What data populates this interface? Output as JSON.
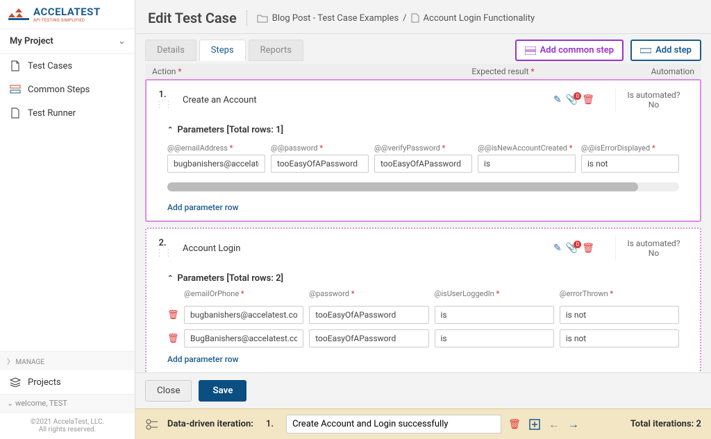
{
  "brand": {
    "name": "ACCELATEST",
    "tagline": "API TESTING SIMPLIFIED"
  },
  "sidebar": {
    "project": "My Project",
    "items": [
      {
        "label": "Test Cases"
      },
      {
        "label": "Common Steps"
      },
      {
        "label": "Test Runner"
      }
    ],
    "manage": "MANAGE",
    "projects": "Projects",
    "welcome": "welcome, TEST",
    "copyright1": "©2021 AccelaTest, LLC.",
    "copyright2": "All rights reserved."
  },
  "header": {
    "title": "Edit Test Case",
    "crumb1": "Blog Post - Test Case Examples",
    "crumb2": "Account Login Functionality"
  },
  "tabs": {
    "details": "Details",
    "steps": "Steps",
    "reports": "Reports"
  },
  "buttons": {
    "addCommon": "Add common step",
    "addStep": "Add step",
    "close": "Close",
    "save": "Save"
  },
  "cols": {
    "action": "Action",
    "expected": "Expected result",
    "automation": "Automation"
  },
  "steps": [
    {
      "num": "1.",
      "title": "Create an Account",
      "autoLabel": "Is automated?",
      "autoVal": "No",
      "paramsHdr": "Parameters [Total rows: 1]",
      "params": [
        {
          "label": "@@emailAddress"
        },
        {
          "label": "@@password"
        },
        {
          "label": "@@verifyPassword"
        },
        {
          "label": "@@isNewAccountCreated"
        },
        {
          "label": "@@isErrorDisplayed"
        }
      ],
      "rows": [
        [
          "bugbanishers@accelatest.com",
          "tooEasyOfAPassword",
          "tooEasyOfAPassword",
          "is",
          "is not"
        ]
      ],
      "addParam": "Add parameter row"
    },
    {
      "num": "2.",
      "title": "Account Login",
      "autoLabel": "Is automated?",
      "autoVal": "No",
      "paramsHdr": "Parameters [Total rows: 2]",
      "params": [
        {
          "label": "@emailOrPhone"
        },
        {
          "label": "@password"
        },
        {
          "label": "@isUserLoggedIn"
        },
        {
          "label": "@errorThrown"
        }
      ],
      "rows": [
        [
          "bugbanishers@accelatest.com",
          "tooEasyOfAPassword",
          "is",
          "is not"
        ],
        [
          "BugBanishers@accelatest.com",
          "tooEasyOfAPassword",
          "is",
          "is not"
        ]
      ],
      "addParam": "Add parameter row"
    }
  ],
  "iteration": {
    "label": "Data-driven iteration:",
    "num": "1.",
    "name": "Create Account and Login successfully",
    "total": "Total iterations: 2"
  }
}
